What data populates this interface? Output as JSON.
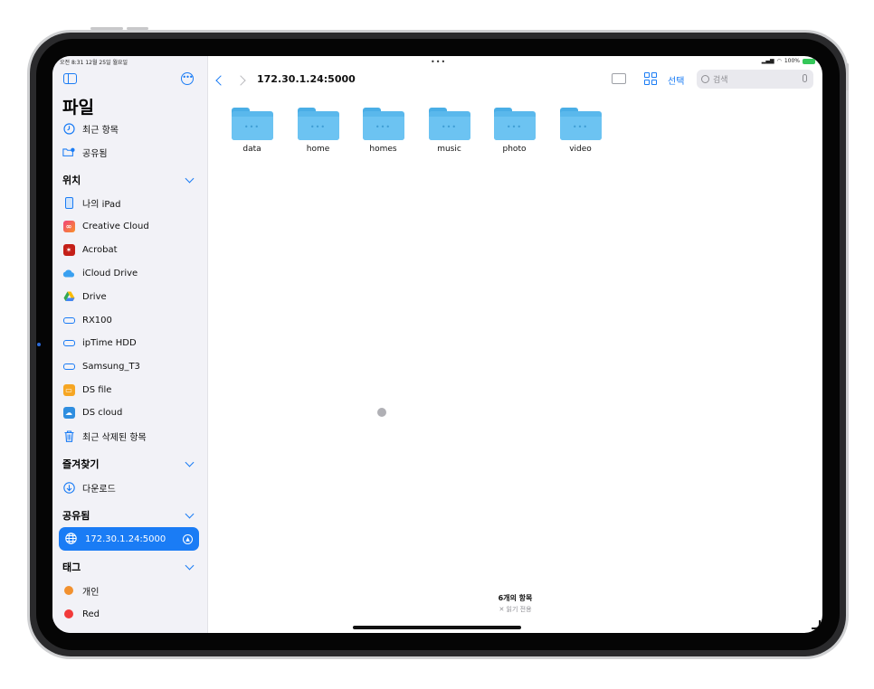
{
  "status": {
    "time_date": "오전 8:31  12월 25일 월요일",
    "battery": "100%",
    "multitask_dots": "•••"
  },
  "sidebar": {
    "title": "파일",
    "top_items": [
      {
        "label": "최근 항목",
        "icon": "clock-icon"
      },
      {
        "label": "공유됨",
        "icon": "shared-folder-icon"
      }
    ],
    "sections": {
      "locations": {
        "title": "위치"
      },
      "favorites": {
        "title": "즐겨찾기"
      },
      "shared": {
        "title": "공유됨"
      },
      "tags": {
        "title": "태그"
      }
    },
    "locations": [
      {
        "label": "나의 iPad",
        "icon": "ipad-icon"
      },
      {
        "label": "Creative Cloud",
        "icon": "creative-cloud-icon"
      },
      {
        "label": "Acrobat",
        "icon": "acrobat-icon"
      },
      {
        "label": "iCloud Drive",
        "icon": "icloud-icon"
      },
      {
        "label": "Drive",
        "icon": "google-drive-icon"
      },
      {
        "label": "RX100",
        "icon": "drive-icon"
      },
      {
        "label": "ipTime HDD",
        "icon": "drive-icon"
      },
      {
        "label": "Samsung_T3",
        "icon": "drive-icon"
      },
      {
        "label": "DS file",
        "icon": "ds-file-icon"
      },
      {
        "label": "DS cloud",
        "icon": "ds-cloud-icon"
      },
      {
        "label": "최근 삭제된 항목",
        "icon": "trash-icon"
      }
    ],
    "favorites": [
      {
        "label": "다운로드",
        "icon": "download-icon"
      }
    ],
    "shared": [
      {
        "label": "172.30.1.24:5000",
        "icon": "globe-icon"
      }
    ],
    "tags": [
      {
        "label": "개인",
        "color": "#f2912f"
      },
      {
        "label": "Red",
        "color": "#f23a3a"
      }
    ]
  },
  "toolbar": {
    "path": "172.30.1.24:5000",
    "select_label": "선택",
    "search_placeholder": "검색"
  },
  "folders": [
    "data",
    "home",
    "homes",
    "music",
    "photo",
    "video"
  ],
  "footer": {
    "count": "6개의 항목",
    "readonly": "읽기 전용"
  },
  "colors": {
    "accent": "#1a7cf5",
    "folder": "#5ab8ec"
  }
}
